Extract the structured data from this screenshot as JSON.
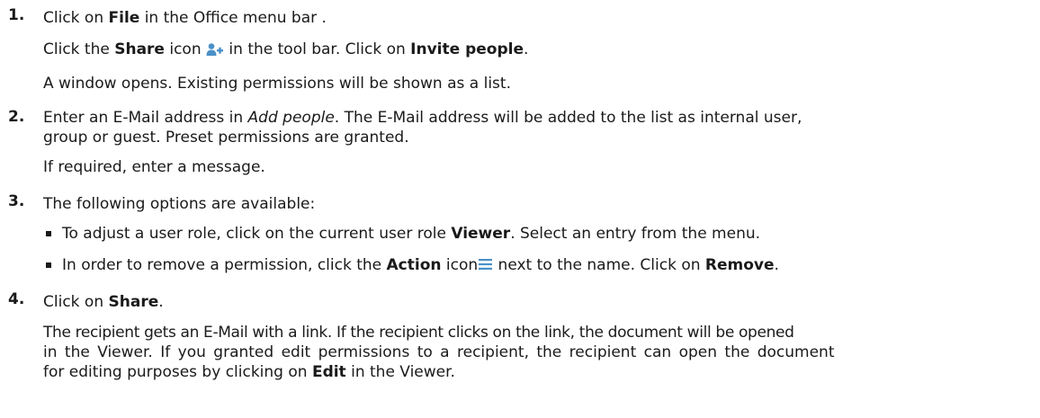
{
  "steps": [
    {
      "number": "1.",
      "line1": {
        "a": "Click on ",
        "b": "File",
        "c": " in the Office menu bar ."
      },
      "line2": {
        "a": "Click the ",
        "b": "Share",
        "c": " icon ",
        "d": " in the tool bar. Click on ",
        "e": "Invite people",
        "f": "."
      },
      "line3": "A window opens. Existing permissions will be shown as a list."
    },
    {
      "number": "2.",
      "line1": {
        "a": "Enter an E-Mail address in ",
        "i": "Add people",
        "c": ". The E-Mail address will be added to the list as internal user,"
      },
      "line2": "group or guest. Preset permissions are granted.",
      "line3": "If required, enter a message."
    },
    {
      "number": "3.",
      "line1": "The following options are available:",
      "bullets": [
        {
          "a": "To adjust a user role, click on the current user role ",
          "b": "Viewer",
          "c": ". Select an entry from the menu."
        },
        {
          "a": "In order to remove a permission, click the ",
          "b": "Action",
          "c": " icon",
          "d": " next to the name. Click on ",
          "e": "Remove",
          "f": "."
        }
      ]
    },
    {
      "number": "4.",
      "line1": {
        "a": "Click on ",
        "b": "Share",
        "c": "."
      },
      "para": {
        "l1": "The recipient gets an E-Mail with a link. If the recipient clicks on the link, the document will be opened",
        "l2": "in the Viewer. If you granted edit permissions to a recipient, the recipient can open the document",
        "l3a": "for editing purposes by clicking on ",
        "l3b": "Edit",
        "l3c": " in the Viewer."
      }
    }
  ],
  "icons": {
    "share": "share-person-plus-icon",
    "action": "hamburger-menu-icon",
    "accent_color": "#4a90c8"
  }
}
